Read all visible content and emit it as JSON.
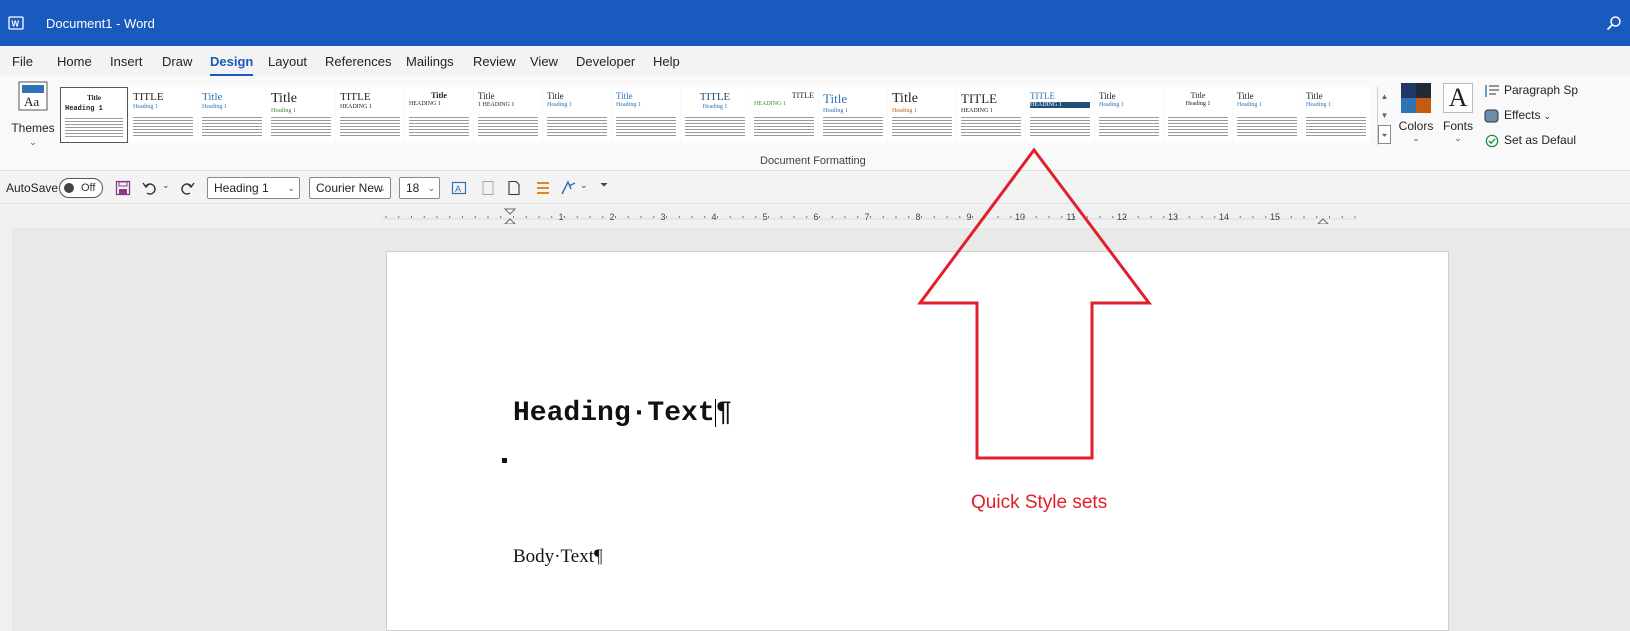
{
  "window": {
    "title": "Document1  -  Word"
  },
  "menu": {
    "tabs": [
      {
        "label": "File"
      },
      {
        "label": "Home"
      },
      {
        "label": "Insert"
      },
      {
        "label": "Draw"
      },
      {
        "label": "Design"
      },
      {
        "label": "Layout"
      },
      {
        "label": "References"
      },
      {
        "label": "Mailings"
      },
      {
        "label": "Review"
      },
      {
        "label": "View"
      },
      {
        "label": "Developer"
      },
      {
        "label": "Help"
      }
    ],
    "active": "Design"
  },
  "ribbon": {
    "themes_label": "Themes",
    "gallery": [
      {
        "title": "Title",
        "heading": "Heading 1",
        "selected": true
      },
      {
        "title": "TITLE",
        "heading": "Heading 1"
      },
      {
        "title": "Title",
        "heading": "Heading 1"
      },
      {
        "title": "Title",
        "heading": "Heading 1"
      },
      {
        "title": "TITLE",
        "heading": "HEADING 1"
      },
      {
        "title": "Title",
        "heading": "HEADING 1"
      },
      {
        "title": "Title",
        "heading": "1  HEADING 1"
      },
      {
        "title": "Title",
        "heading": "Heading 1"
      },
      {
        "title": "Title",
        "heading": "Heading 1"
      },
      {
        "title": "TITLE",
        "heading": "Heading 1"
      },
      {
        "title": "TITLE",
        "heading": "HEADING 1"
      },
      {
        "title": "Title",
        "heading": "Heading 1"
      },
      {
        "title": "Title",
        "heading": "Heading 1"
      },
      {
        "title": "TITLE",
        "heading": "HEADING 1"
      },
      {
        "title": "TITLE",
        "heading": "HEADING 1"
      },
      {
        "title": "Title",
        "heading": "Heading 1"
      },
      {
        "title": "Title",
        "heading": "Heading 1"
      },
      {
        "title": "Title",
        "heading": "Heading 1"
      },
      {
        "title": "Title",
        "heading": "Heading 1"
      }
    ],
    "colors_label": "Colors",
    "fonts_label": "Fonts",
    "paragraph_spacing_label": "Paragraph Sp",
    "effects_label": "Effects",
    "set_default_label": "Set as Defaul",
    "group_label": "Document Formatting"
  },
  "qat": {
    "autosave_label": "AutoSave",
    "autosave_state": "Off",
    "style_value": "Heading 1",
    "font_value": "Courier New",
    "size_value": "18"
  },
  "ruler": {
    "numbers": [
      "1",
      "2",
      "3",
      "4",
      "5",
      "6",
      "7",
      "8",
      "9",
      "10",
      "11",
      "12",
      "13",
      "14",
      "15"
    ]
  },
  "document": {
    "heading": "Heading·Text",
    "heading_mark": "¶",
    "body": "Body·Text¶"
  },
  "annotation": {
    "label": "Quick Style sets",
    "color": "#e0202a"
  },
  "colors": {
    "titlebar": "#185abd",
    "accent": "#185abd"
  }
}
